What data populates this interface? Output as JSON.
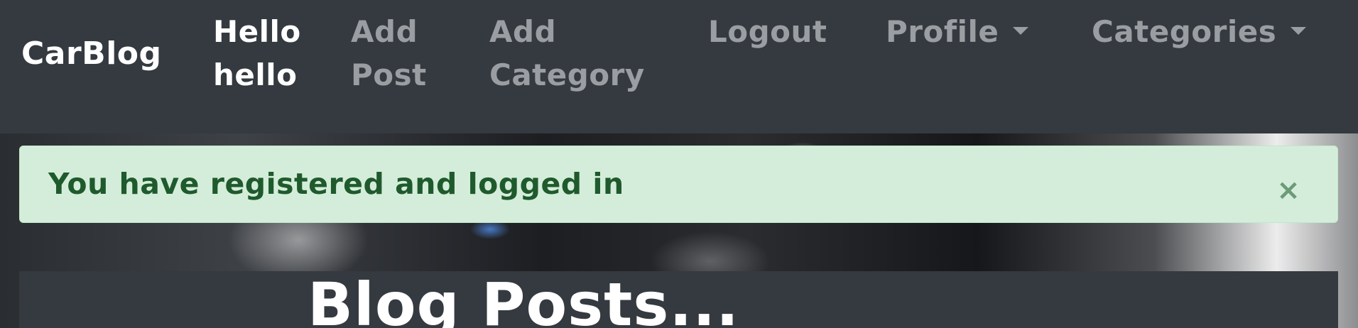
{
  "navbar": {
    "brand": "CarBlog",
    "user_greeting": [
      "Hello",
      "hello"
    ],
    "add_post": [
      "Add",
      "Post"
    ],
    "add_category": [
      "Add",
      "Category"
    ],
    "logout": "Logout",
    "profile": "Profile",
    "categories": "Categories"
  },
  "alert": {
    "message": "You have registered and logged in",
    "close_symbol": "×"
  },
  "main": {
    "title": "Blog Posts..."
  },
  "colors": {
    "navbar_bg": "#343a40",
    "nav_active": "#ffffff",
    "nav_muted": "#9a9da1",
    "alert_bg": "#d4edda",
    "alert_text": "#1f5a2c"
  },
  "icons": {
    "dropdown": "caret-down-icon",
    "close": "close-icon"
  }
}
